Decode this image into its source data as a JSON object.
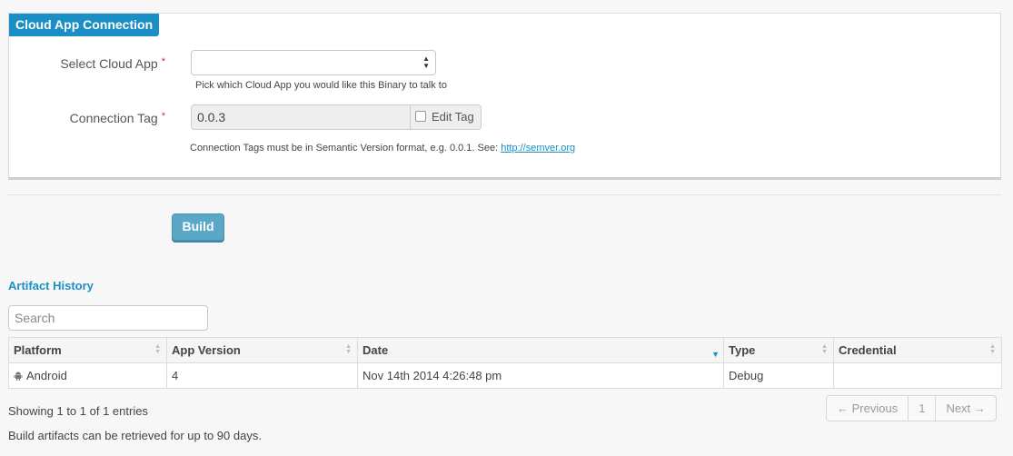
{
  "panel": {
    "title": "Cloud App Connection"
  },
  "cloud_app": {
    "label": "Select Cloud App",
    "required_mark": "*",
    "value": "",
    "help": "Pick which Cloud App you would like this Binary to talk to"
  },
  "connection_tag": {
    "label": "Connection Tag",
    "required_mark": "*",
    "value": "0.0.3",
    "edit_label": "Edit Tag",
    "edit_checked": false,
    "help_prefix": "Connection Tags must be in Semantic Version format, e.g. 0.0.1. See: ",
    "help_link": "http://semver.org"
  },
  "build_button": "Build",
  "history": {
    "title": "Artifact History",
    "search_placeholder": "Search",
    "columns": [
      "Platform",
      "App Version",
      "Date",
      "Type",
      "Credential"
    ],
    "sorted_column": "Date",
    "rows": [
      {
        "platform": "Android",
        "app_version": "4",
        "date": "Nov 14th 2014 4:26:48 pm",
        "type": "Debug",
        "credential": ""
      }
    ],
    "info": "Showing 1 to 1 of 1 entries",
    "note": "Build artifacts can be retrieved for up to 90 days."
  },
  "pagination": {
    "previous": "← Previous",
    "page": "1",
    "next": "Next →"
  },
  "colors": {
    "accent": "#1a8fc6",
    "build_button": "#5ba7c7",
    "required": "#c0392b"
  }
}
